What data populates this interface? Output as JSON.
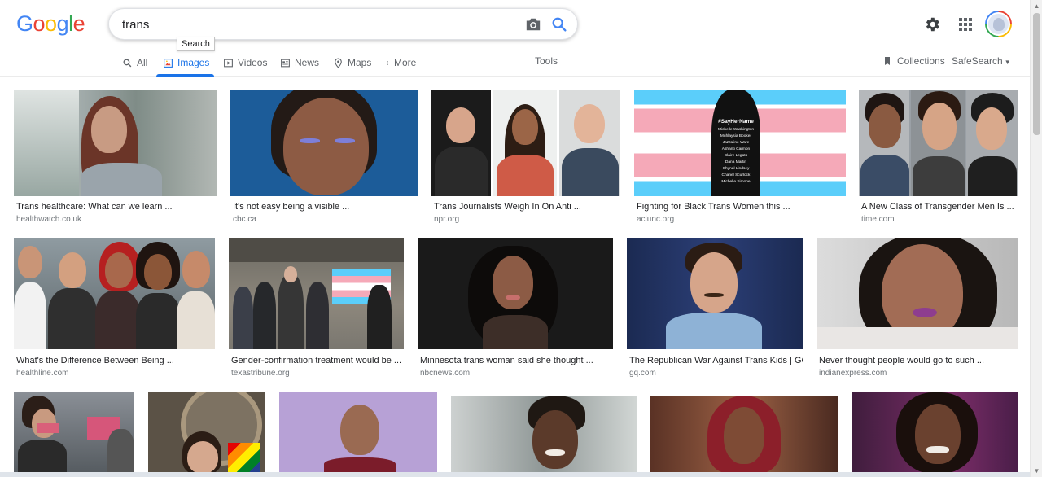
{
  "logo": {
    "letters": [
      "G",
      "o",
      "o",
      "g",
      "l",
      "e"
    ],
    "colors": [
      "#4285f4",
      "#ea4335",
      "#fbbc05",
      "#4285f4",
      "#34a853",
      "#ea4335"
    ]
  },
  "search": {
    "query": "trans",
    "tooltip": "Search"
  },
  "tabs": [
    {
      "label": "All",
      "icon": "search-icon"
    },
    {
      "label": "Images",
      "icon": "image-icon",
      "active": true
    },
    {
      "label": "Videos",
      "icon": "play-icon"
    },
    {
      "label": "News",
      "icon": "news-icon"
    },
    {
      "label": "Maps",
      "icon": "map-pin-icon"
    },
    {
      "label": "More",
      "icon": "more-dots-icon"
    }
  ],
  "tools_label": "Tools",
  "collections_label": "Collections",
  "safesearch_label": "SafeSearch",
  "results": [
    {
      "caption": "Trans healthcare: What can we learn ...",
      "source": "healthwatch.co.uk"
    },
    {
      "caption": "It's not easy being a visible ...",
      "source": "cbc.ca"
    },
    {
      "caption": "Trans Journalists Weigh In On Anti ...",
      "source": "npr.org"
    },
    {
      "caption": "Fighting for Black Trans Women this ...",
      "source": "aclunc.org"
    },
    {
      "caption": "A New Class of Transgender Men Is ...",
      "source": "time.com"
    },
    {
      "caption": "What's the Difference Between Being ...",
      "source": "healthline.com"
    },
    {
      "caption": "Gender-confirmation treatment would be ...",
      "source": "texastribune.org"
    },
    {
      "caption": "Minnesota trans woman said she thought ...",
      "source": "nbcnews.com"
    },
    {
      "caption": "The Republican War Against Trans Kids | GQ",
      "source": "gq.com"
    },
    {
      "caption": "Never thought people would go to such ...",
      "source": "indianexpress.com"
    }
  ],
  "poster": {
    "hashtag": "#SayHerName",
    "names": [
      "Michelle Washington",
      "Muhlaysia Booker",
      "Jazzaline Ware",
      "Ashanti Carmon",
      "Claire Legato",
      "Dana Martin",
      "Chynal Lindsey",
      "Chanel Scurlock",
      "Michelle Simone"
    ]
  },
  "colors": {
    "accent": "#1a73e8",
    "trans_blue": "#5bcefa",
    "trans_pink": "#f5a9b8"
  }
}
